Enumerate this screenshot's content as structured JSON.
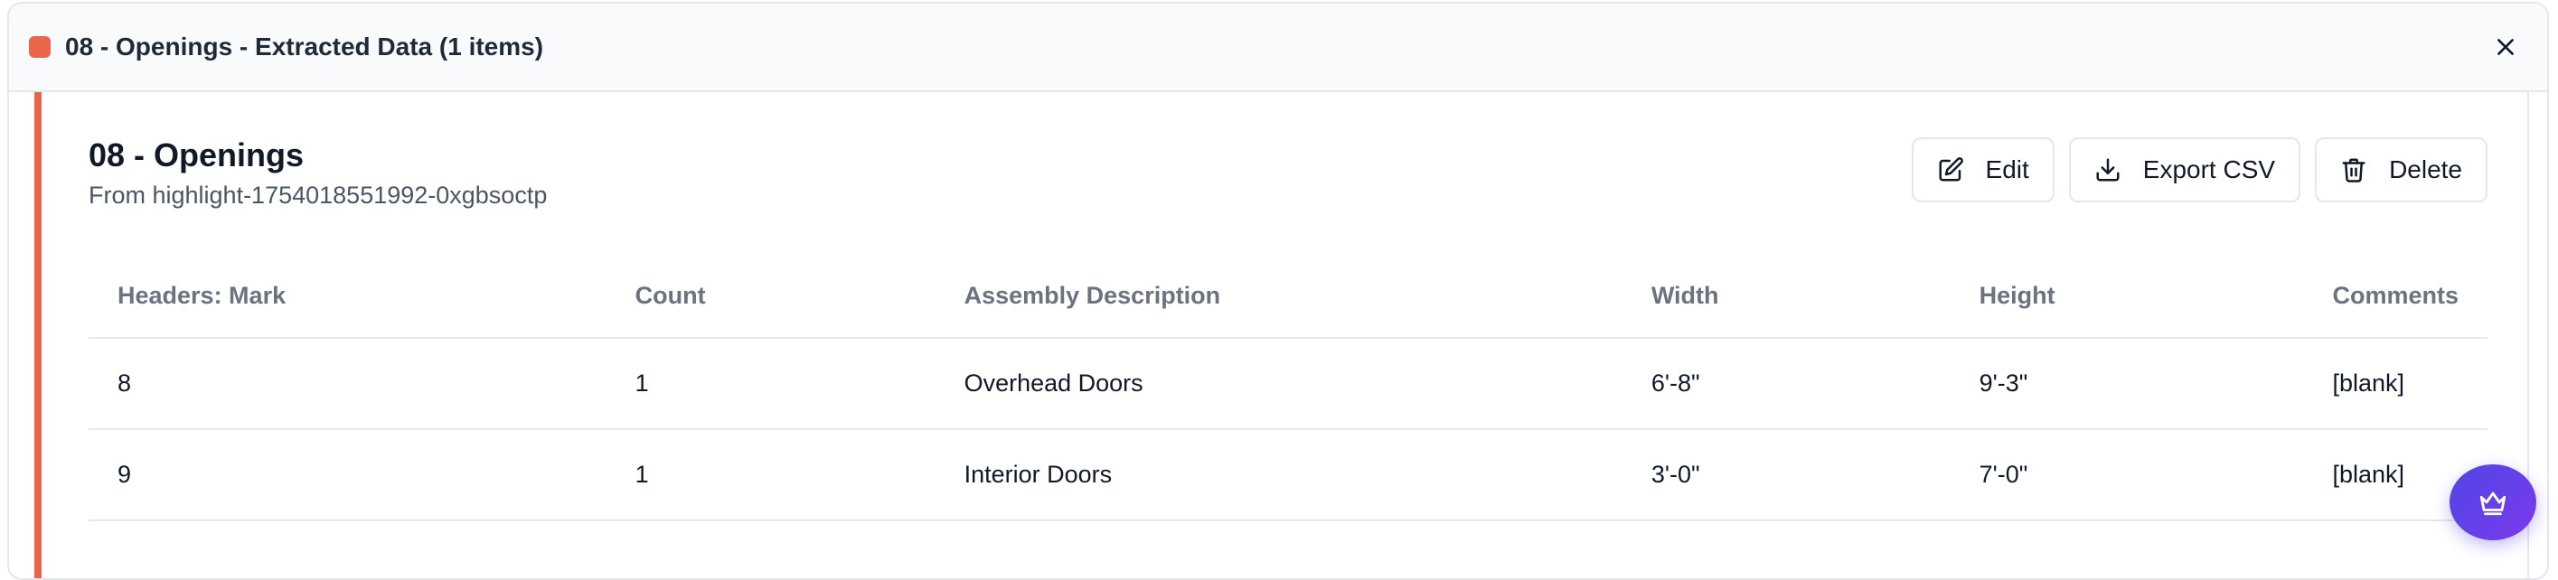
{
  "window": {
    "title": "08 - Openings - Extracted Data (1 items)",
    "accent_color": "#e9664a"
  },
  "card": {
    "title": "08 - Openings",
    "subtitle": "From highlight-1754018551992-0xgbsoctp"
  },
  "actions": {
    "edit_label": "Edit",
    "export_label": "Export CSV",
    "delete_label": "Delete"
  },
  "table": {
    "headers": [
      "Headers: Mark",
      "Count",
      "Assembly Description",
      "Width",
      "Height",
      "Comments"
    ],
    "rows": [
      [
        "8",
        "1",
        "Overhead Doors",
        "6'-8\"",
        "9'-3\"",
        "[blank]"
      ],
      [
        "9",
        "1",
        "Interior Doors",
        "3'-0\"",
        "7'-0\"",
        "[blank]"
      ]
    ]
  },
  "icons": {
    "close": "close-icon",
    "edit": "edit-icon",
    "export": "download-icon",
    "delete": "trash-icon",
    "fab": "crown-icon"
  }
}
